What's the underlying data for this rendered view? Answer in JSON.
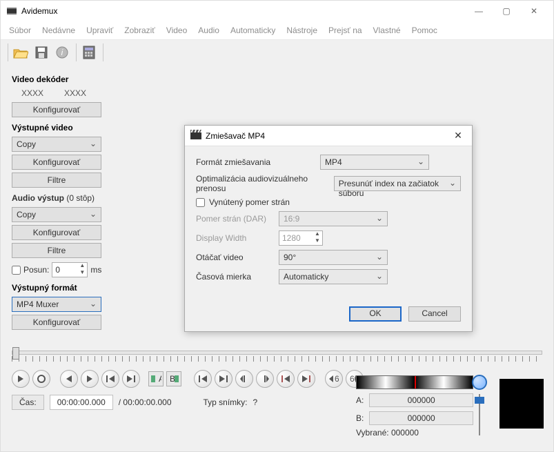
{
  "app": {
    "title": "Avidemux"
  },
  "menu": {
    "items": [
      "Súbor",
      "Nedávne",
      "Upraviť",
      "Zobraziť",
      "Video",
      "Audio",
      "Automaticky",
      "Nástroje",
      "Prejsť na",
      "Vlastné",
      "Pomoc"
    ]
  },
  "sidebar": {
    "decoder": {
      "title": "Video dekóder",
      "l1": "XXXX",
      "l2": "XXXX",
      "configure": "Konfigurovať"
    },
    "video_out": {
      "title": "Výstupné video",
      "codec": "Copy",
      "configure": "Konfigurovať",
      "filters": "Filtre"
    },
    "audio_out": {
      "title": "Audio výstup",
      "tracks": "(0 stôp)",
      "codec": "Copy",
      "configure": "Konfigurovať",
      "filters": "Filtre",
      "shift_label": "Posun:",
      "shift_value": "0",
      "shift_unit": "ms"
    },
    "format": {
      "title": "Výstupný formát",
      "muxer": "MP4 Muxer",
      "configure": "Konfigurovať"
    }
  },
  "status": {
    "time_label": "Čas:",
    "time_value": "00:00:00.000",
    "duration": "/ 00:00:00.000",
    "frametype_label": "Typ snímky:",
    "frametype_value": "?"
  },
  "ab": {
    "a_label": "A:",
    "a_value": "000000",
    "b_label": "B:",
    "b_value": "000000",
    "sel_label": "Vybrané:",
    "sel_value": "000000"
  },
  "dialog": {
    "title": "Zmiešavač MP4",
    "muxing_label": "Formát zmiešavania",
    "muxing_value": "MP4",
    "opt_label": "Optimalizácia audiovizuálneho prenosu",
    "opt_value": "Presunúť index na začiatok súboru",
    "force_ar_label": "Vynútený pomer strán",
    "dar_label": "Pomer strán (DAR)",
    "dar_value": "16:9",
    "width_label": "Display Width",
    "width_value": "1280",
    "rotate_label": "Otáčať video",
    "rotate_value": "90°",
    "clock_label": "Časová mierka",
    "clock_value": "Automaticky",
    "ok": "OK",
    "cancel": "Cancel"
  }
}
